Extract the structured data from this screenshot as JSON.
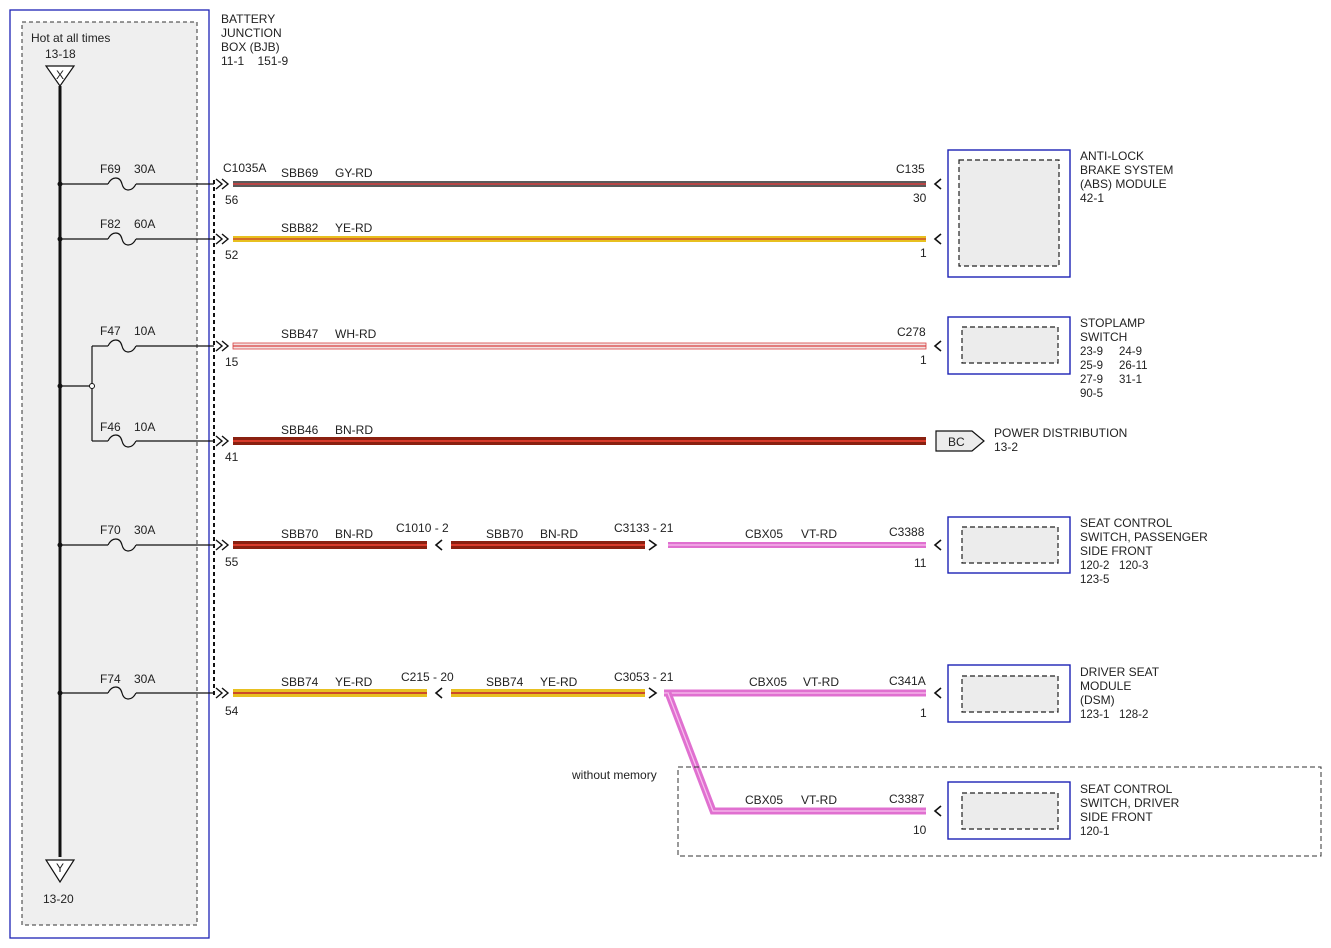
{
  "bjb": {
    "hot_label": "Hot at all times",
    "top_ref": "13-18",
    "top_letter": "X",
    "bottom_ref": "13-20",
    "bottom_letter": "Y",
    "title": [
      "BATTERY",
      "JUNCTION",
      "BOX (BJB)"
    ],
    "refs": "11-1    151-9"
  },
  "connector_main": "C1035A",
  "circuits": [
    {
      "id": "f69",
      "fuse": "F69",
      "amps": "30A",
      "pin": "56",
      "circuit": "SBB69",
      "color_code": "GY-RD",
      "dest_connector": "C135",
      "dest_pin": "30",
      "stripe_base": "#5a5a5a",
      "stripe_trace": "#d84040"
    },
    {
      "id": "f82",
      "fuse": "F82",
      "amps": "60A",
      "pin": "52",
      "circuit": "SBB82",
      "color_code": "YE-RD",
      "dest_connector": "",
      "dest_pin": "1",
      "stripe_base": "#e8c020",
      "stripe_trace": "#c83a2a"
    },
    {
      "id": "f47",
      "fuse": "F47",
      "amps": "10A",
      "pin": "15",
      "circuit": "SBB47",
      "color_code": "WH-RD",
      "dest_connector": "C278",
      "dest_pin": "1",
      "stripe_base": "#f2e2e2",
      "stripe_trace": "#d84040"
    },
    {
      "id": "f46",
      "fuse": "F46",
      "amps": "10A",
      "pin": "41",
      "circuit": "SBB46",
      "color_code": "BN-RD",
      "dest_connector": "",
      "dest_pin": "",
      "stripe_base": "#8a2010",
      "stripe_trace": "#d83a2a"
    },
    {
      "id": "f70",
      "fuse": "F70",
      "amps": "30A",
      "pin": "55",
      "circuit": "SBB70",
      "color_code": "BN-RD",
      "inline1": "C1010 - 2",
      "circuit2": "SBB70",
      "color_code2": "BN-RD",
      "inline2": "C3133 - 21",
      "circuit3": "CBX05",
      "color_code3": "VT-RD",
      "dest_connector": "C3388",
      "dest_pin": "11"
    },
    {
      "id": "f74",
      "fuse": "F74",
      "amps": "30A",
      "pin": "54",
      "circuit": "SBB74",
      "color_code": "YE-RD",
      "inline1": "C215 - 20",
      "circuit2": "SBB74",
      "color_code2": "YE-RD",
      "inline2": "C3053 - 21",
      "circuit3": "CBX05",
      "color_code3": "VT-RD",
      "dest_connector": "C341A",
      "dest_pin": "1"
    }
  ],
  "branch": {
    "option_label": "without memory",
    "circuit": "CBX05",
    "color_code": "VT-RD",
    "dest_connector": "C3387",
    "dest_pin": "10"
  },
  "components": {
    "abs": {
      "lines": [
        "ANTI-LOCK",
        "BRAKE SYSTEM",
        "(ABS) MODULE",
        "42-1"
      ]
    },
    "stoplamp": {
      "lines": [
        "STOPLAMP",
        "SWITCH",
        "23-9     24-9",
        "25-9     26-11",
        "27-9     31-1",
        "90-5"
      ]
    },
    "power_dist": {
      "tag": "BC",
      "lines": [
        "POWER DISTRIBUTION",
        "13-2"
      ]
    },
    "seat_pass": {
      "lines": [
        "SEAT CONTROL",
        "SWITCH, PASSENGER",
        "SIDE FRONT",
        "120-2   120-3",
        "123-5"
      ]
    },
    "dsm": {
      "lines": [
        "DRIVER SEAT",
        "MODULE",
        "(DSM)",
        "123-1   128-2"
      ]
    },
    "seat_drv": {
      "lines": [
        "SEAT CONTROL",
        "SWITCH, DRIVER",
        "SIDE FRONT",
        "120-1"
      ]
    }
  },
  "colors": {
    "frame_blue": "#1d22b5",
    "wire_black": "#111111",
    "yellow": "#e8c020",
    "red": "#c8352a",
    "brown": "#8a2010",
    "violet": "#e070d0",
    "pink_trace": "#f0a0e0",
    "module_fill": "#ececec"
  }
}
